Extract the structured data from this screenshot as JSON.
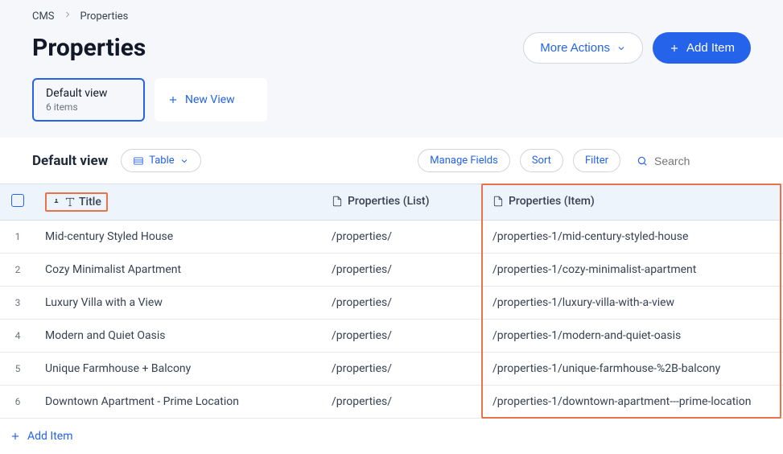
{
  "breadcrumb": {
    "root": "CMS",
    "current": "Properties"
  },
  "page": {
    "title": "Properties"
  },
  "actions": {
    "more": "More Actions",
    "add": "Add Item"
  },
  "views": {
    "active": {
      "title": "Default view",
      "sub": "6 items"
    },
    "new": "New View"
  },
  "toolbar": {
    "title": "Default view",
    "view_mode": "Table",
    "manage_fields": "Manage Fields",
    "sort": "Sort",
    "filter": "Filter",
    "search_placeholder": "Search"
  },
  "columns": {
    "title": "Title",
    "list": "Properties (List)",
    "item": "Properties (Item)"
  },
  "rows": [
    {
      "n": "1",
      "title": "Mid-century Styled House",
      "list": "/properties/",
      "item": "/properties-1/mid-century-styled-house"
    },
    {
      "n": "2",
      "title": "Cozy Minimalist Apartment",
      "list": "/properties/",
      "item": "/properties-1/cozy-minimalist-apartment"
    },
    {
      "n": "3",
      "title": "Luxury Villa with a View",
      "list": "/properties/",
      "item": "/properties-1/luxury-villa-with-a-view"
    },
    {
      "n": "4",
      "title": "Modern and Quiet Oasis",
      "list": "/properties/",
      "item": "/properties-1/modern-and-quiet-oasis"
    },
    {
      "n": "5",
      "title": "Unique Farmhouse + Balcony",
      "list": "/properties/",
      "item": "/properties-1/unique-farmhouse-%2B-balcony"
    },
    {
      "n": "6",
      "title": "Downtown Apartment - Prime Location",
      "list": "/properties/",
      "item": "/properties-1/downtown-apartment---prime-location"
    }
  ],
  "footer": {
    "add": "Add Item"
  }
}
